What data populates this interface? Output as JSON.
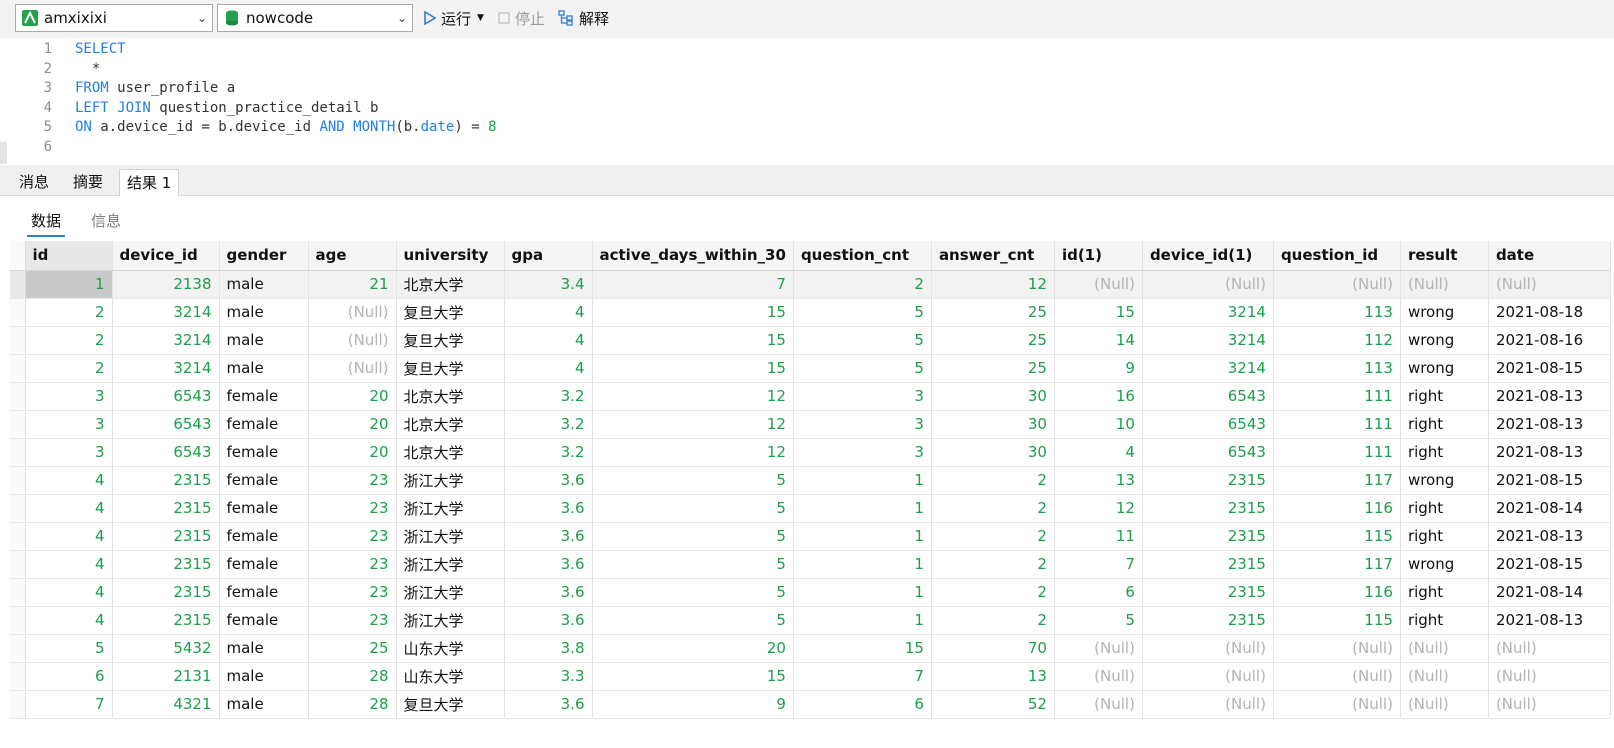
{
  "toolbar": {
    "connection": "amxixixi",
    "database": "nowcode",
    "run_label": "运行",
    "stop_label": "停止",
    "explain_label": "解释",
    "colors": {
      "run": "#2f7fd8",
      "db_icon": "#22a34a",
      "conn_icon": "#22a34a"
    }
  },
  "editor": {
    "line_numbers": [
      "1",
      "2",
      "3",
      "4",
      "5",
      "6"
    ],
    "lines": [
      [
        {
          "t": "SELECT",
          "c": "kw"
        }
      ],
      [
        {
          "t": "  *",
          "c": ""
        }
      ],
      [
        {
          "t": "FROM",
          "c": "kw"
        },
        {
          "t": " user_profile a",
          "c": ""
        }
      ],
      [
        {
          "t": "LEFT JOIN",
          "c": "kw"
        },
        {
          "t": " question_practice_detail b",
          "c": ""
        }
      ],
      [
        {
          "t": "ON",
          "c": "kw"
        },
        {
          "t": " a.device_id = b.device_id ",
          "c": ""
        },
        {
          "t": "AND",
          "c": "kw"
        },
        {
          "t": " ",
          "c": ""
        },
        {
          "t": "MONTH",
          "c": "kw"
        },
        {
          "t": "(b.",
          "c": ""
        },
        {
          "t": "date",
          "c": "kw"
        },
        {
          "t": ") = ",
          "c": ""
        },
        {
          "t": "8",
          "c": "num"
        }
      ],
      []
    ]
  },
  "tabs": {
    "messages": "消息",
    "summary": "摘要",
    "result": "结果 1"
  },
  "subtabs": {
    "data": "数据",
    "info": "信息"
  },
  "grid": {
    "columns": [
      "id",
      "device_id",
      "gender",
      "age",
      "university",
      "gpa",
      "active_days_within_30",
      "question_cnt",
      "answer_cnt",
      "id(1)",
      "device_id(1)",
      "question_id",
      "result",
      "date"
    ],
    "rows": [
      [
        "1",
        "2138",
        "male",
        "21",
        "北京大学",
        "3.4",
        "7",
        "2",
        "12",
        "(Null)",
        "(Null)",
        "(Null)",
        "(Null)",
        "(Null)"
      ],
      [
        "2",
        "3214",
        "male",
        "(Null)",
        "复旦大学",
        "4",
        "15",
        "5",
        "25",
        "15",
        "3214",
        "113",
        "wrong",
        "2021-08-18"
      ],
      [
        "2",
        "3214",
        "male",
        "(Null)",
        "复旦大学",
        "4",
        "15",
        "5",
        "25",
        "14",
        "3214",
        "112",
        "wrong",
        "2021-08-16"
      ],
      [
        "2",
        "3214",
        "male",
        "(Null)",
        "复旦大学",
        "4",
        "15",
        "5",
        "25",
        "9",
        "3214",
        "113",
        "wrong",
        "2021-08-15"
      ],
      [
        "3",
        "6543",
        "female",
        "20",
        "北京大学",
        "3.2",
        "12",
        "3",
        "30",
        "16",
        "6543",
        "111",
        "right",
        "2021-08-13"
      ],
      [
        "3",
        "6543",
        "female",
        "20",
        "北京大学",
        "3.2",
        "12",
        "3",
        "30",
        "10",
        "6543",
        "111",
        "right",
        "2021-08-13"
      ],
      [
        "3",
        "6543",
        "female",
        "20",
        "北京大学",
        "3.2",
        "12",
        "3",
        "30",
        "4",
        "6543",
        "111",
        "right",
        "2021-08-13"
      ],
      [
        "4",
        "2315",
        "female",
        "23",
        "浙江大学",
        "3.6",
        "5",
        "1",
        "2",
        "13",
        "2315",
        "117",
        "wrong",
        "2021-08-15"
      ],
      [
        "4",
        "2315",
        "female",
        "23",
        "浙江大学",
        "3.6",
        "5",
        "1",
        "2",
        "12",
        "2315",
        "116",
        "right",
        "2021-08-14"
      ],
      [
        "4",
        "2315",
        "female",
        "23",
        "浙江大学",
        "3.6",
        "5",
        "1",
        "2",
        "11",
        "2315",
        "115",
        "right",
        "2021-08-13"
      ],
      [
        "4",
        "2315",
        "female",
        "23",
        "浙江大学",
        "3.6",
        "5",
        "1",
        "2",
        "7",
        "2315",
        "117",
        "wrong",
        "2021-08-15"
      ],
      [
        "4",
        "2315",
        "female",
        "23",
        "浙江大学",
        "3.6",
        "5",
        "1",
        "2",
        "6",
        "2315",
        "116",
        "right",
        "2021-08-14"
      ],
      [
        "4",
        "2315",
        "female",
        "23",
        "浙江大学",
        "3.6",
        "5",
        "1",
        "2",
        "5",
        "2315",
        "115",
        "right",
        "2021-08-13"
      ],
      [
        "5",
        "5432",
        "male",
        "25",
        "山东大学",
        "3.8",
        "20",
        "15",
        "70",
        "(Null)",
        "(Null)",
        "(Null)",
        "(Null)",
        "(Null)"
      ],
      [
        "6",
        "2131",
        "male",
        "28",
        "山东大学",
        "3.3",
        "15",
        "7",
        "13",
        "(Null)",
        "(Null)",
        "(Null)",
        "(Null)",
        "(Null)"
      ],
      [
        "7",
        "4321",
        "male",
        "28",
        "复旦大学",
        "3.6",
        "9",
        "6",
        "52",
        "(Null)",
        "(Null)",
        "(Null)",
        "(Null)",
        "(Null)"
      ]
    ]
  }
}
